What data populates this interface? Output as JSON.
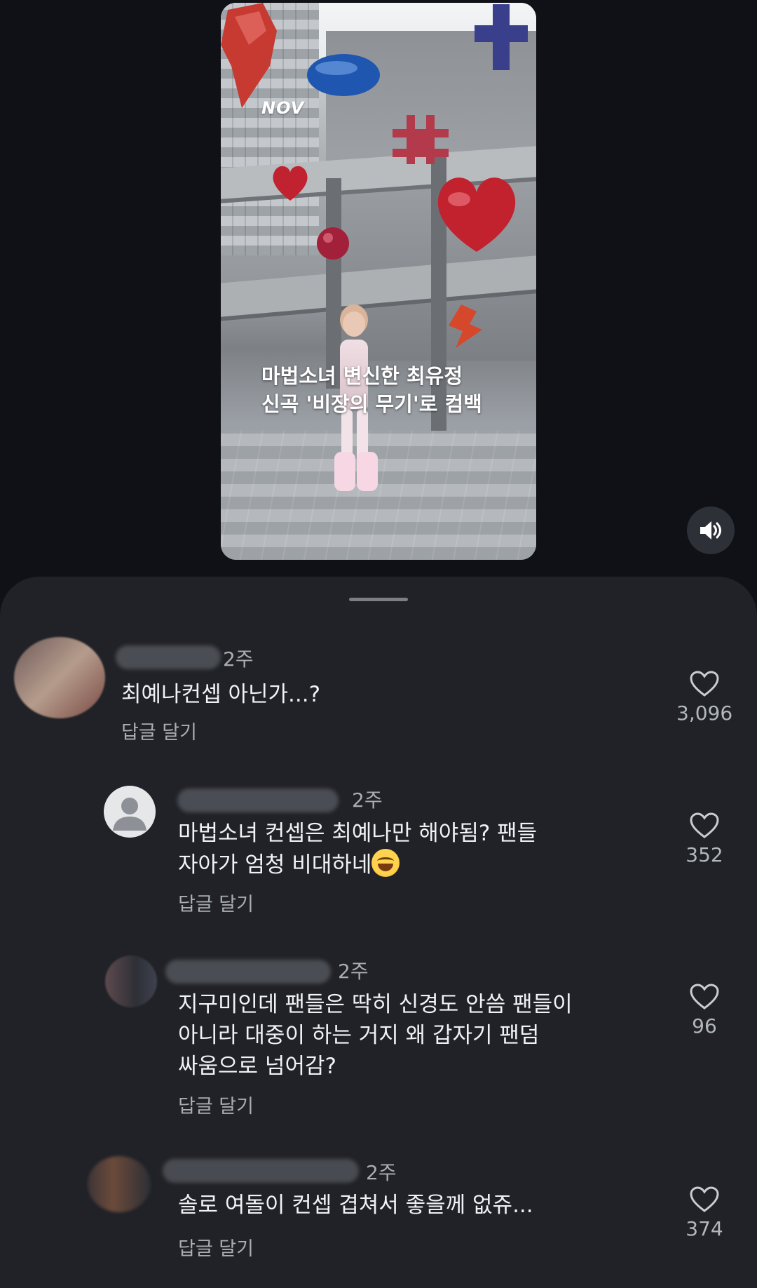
{
  "video": {
    "brand_logo": "NOV",
    "caption_line1": "마법소녀 변신한 최유정",
    "caption_line2": "신곡 '비장의 무기'로 컴백",
    "sound_icon": "speaker-icon"
  },
  "comments": [
    {
      "time": "2주",
      "text": "최예나컨셉 아닌가...?",
      "reply_label": "답글 달기",
      "likes": "3,096"
    },
    {
      "time": "2주",
      "text_line1": "마법소녀 컨셉은 최예나만 해야됨? 팬들",
      "text_line2": "자아가 엄청 비대하네",
      "reply_label": "답글 달기",
      "likes": "352"
    },
    {
      "time": "2주",
      "text_line1": "지구미인데 팬들은 딱히 신경도 안씀 팬들이",
      "text_line2": "아니라 대중이 하는 거지 왜 갑자기 팬덤",
      "text_line3": "싸움으로 넘어감?",
      "reply_label": "답글 달기",
      "likes": "96"
    },
    {
      "time": "2주",
      "text": "솔로 여돌이 컨셉 겹쳐서 좋을께 없쥬...",
      "reply_label": "답글 달기",
      "likes": "374"
    }
  ],
  "colors": {
    "background": "#0f1116",
    "sheet": "#202227",
    "secondary_text": "#a9adb4"
  }
}
